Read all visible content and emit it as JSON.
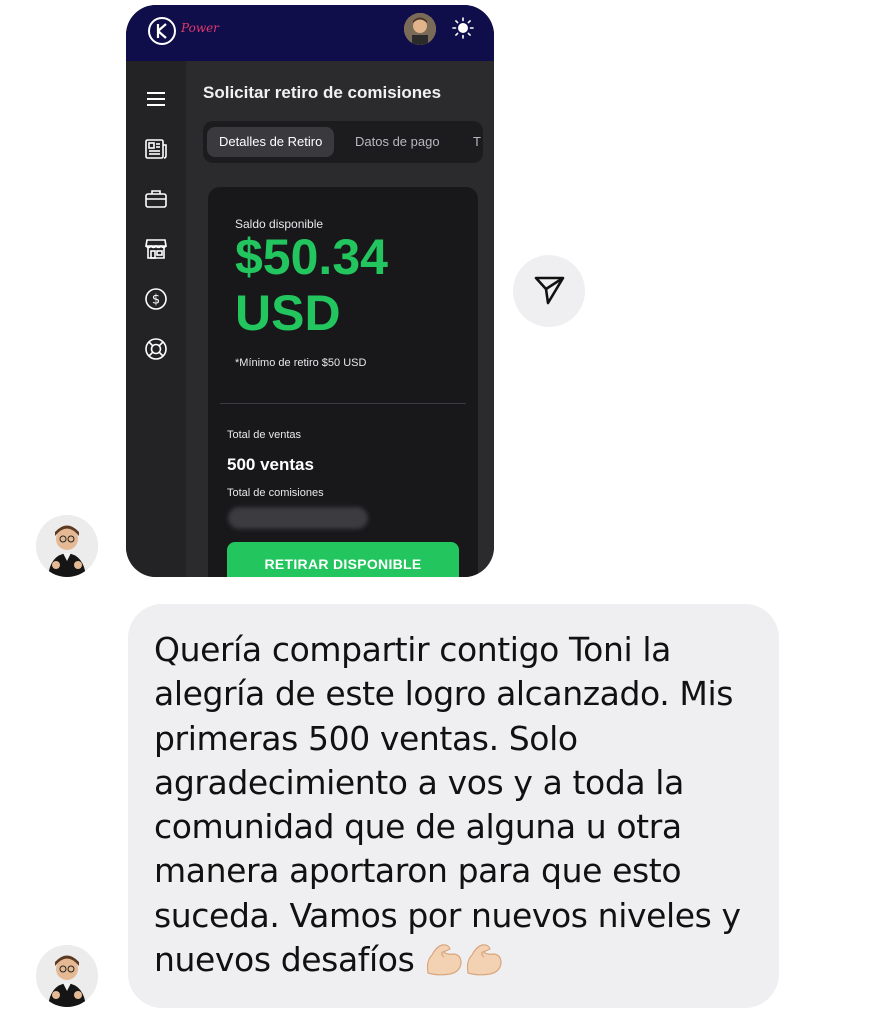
{
  "app": {
    "brand": "Power",
    "page_title": "Solicitar retiro de comisiones",
    "tabs": [
      {
        "label": "Detalles de Retiro",
        "active": true
      },
      {
        "label": "Datos de pago",
        "active": false
      },
      {
        "label": "T",
        "active": false
      }
    ],
    "sidebar_icons": [
      "menu-icon",
      "newspaper-icon",
      "briefcase-icon",
      "store-icon",
      "dollar-icon",
      "lifebuoy-icon"
    ],
    "balance": {
      "label": "Saldo disponible",
      "amount": "$50.34",
      "currency": "USD",
      "minimum_note": "*Mínimo de retiro $50 USD"
    },
    "total_sales_label": "Total de ventas",
    "total_sales_value": "500 ventas",
    "total_commissions_label": "Total de comisiones",
    "withdraw_button": "RETIRAR DISPONIBLE",
    "colors": {
      "topbar": "#0f0d4a",
      "accent_green": "#22c55e",
      "brand_pink": "#e23a6e"
    }
  },
  "chat": {
    "message": "Quería compartir contigo Toni la alegría de este logro alcanzado. Mis primeras 500 ventas. Solo agradecimiento a vos y a toda la comunidad que de alguna u otra manera aportaron para que esto suceda. Vamos por nuevos niveles y nuevos desafíos",
    "emojis": [
      "flexed-biceps-icon",
      "flexed-biceps-icon"
    ],
    "bubble_color": "#efeff1"
  }
}
